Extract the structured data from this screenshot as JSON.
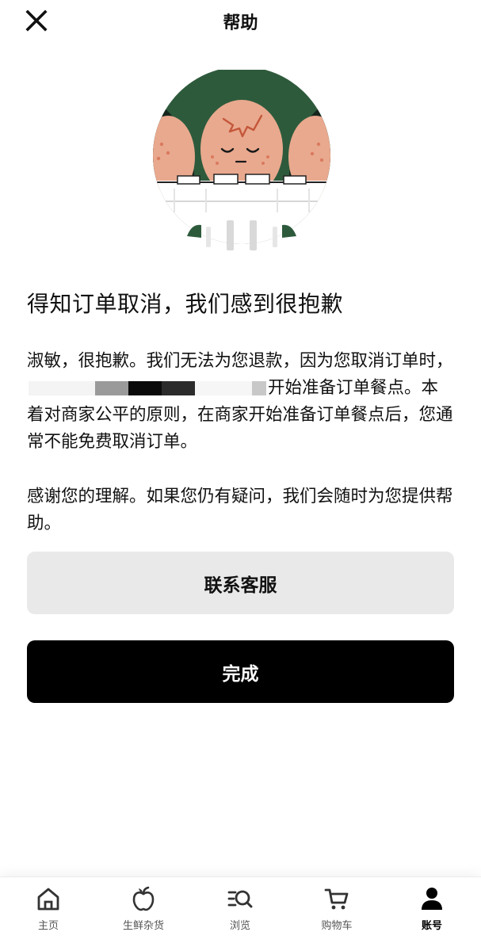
{
  "header": {
    "title": "帮助",
    "close_icon": "close-icon"
  },
  "illustration": {
    "icon": "sad-egg-carton-illustration",
    "colors": {
      "background": "#2e5a3c",
      "egg": "#e9a98e",
      "carton": "#ffffff"
    }
  },
  "message": {
    "headline": "得知订单取消，我们感到很抱歉",
    "paragraph1_start": "淑敏，很抱歉。我们无法为您退款，因为您取消订单时，",
    "paragraph1_end": "开始准备订单餐点。本着对商家公平的原则，在商家开始准备订单餐点后，您通常不能免费取消订单。",
    "paragraph2": "感谢您的理解。如果您仍有疑问，我们会随时为您提供帮助。"
  },
  "actions": {
    "contact_label": "联系客服",
    "done_label": "完成"
  },
  "tabbar": {
    "items": [
      {
        "label": "主页",
        "icon": "home-icon",
        "active": false
      },
      {
        "label": "生鲜杂货",
        "icon": "apple-icon",
        "active": false
      },
      {
        "label": "浏览",
        "icon": "browse-search-icon",
        "active": false
      },
      {
        "label": "购物车",
        "icon": "cart-icon",
        "active": false
      },
      {
        "label": "账号",
        "icon": "account-icon",
        "active": true
      }
    ]
  },
  "colors": {
    "primary_button": "#000000",
    "secondary_button": "#e9e9e9",
    "text": "#111111"
  }
}
